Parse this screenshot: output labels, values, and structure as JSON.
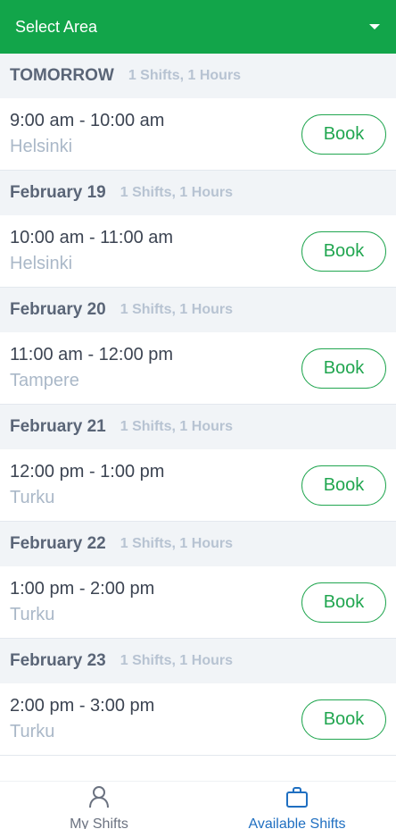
{
  "header": {
    "title": "Select Area"
  },
  "sections": [
    {
      "date": "TOMORROW",
      "meta": "1 Shifts, 1 Hours",
      "time": "9:00 am - 10:00 am",
      "city": "Helsinki",
      "button": "Book"
    },
    {
      "date": "February 19",
      "meta": "1 Shifts, 1 Hours",
      "time": "10:00 am - 11:00 am",
      "city": "Helsinki",
      "button": "Book"
    },
    {
      "date": "February 20",
      "meta": "1 Shifts, 1 Hours",
      "time": "11:00 am - 12:00 pm",
      "city": "Tampere",
      "button": "Book"
    },
    {
      "date": "February 21",
      "meta": "1 Shifts, 1 Hours",
      "time": "12:00 pm - 1:00 pm",
      "city": "Turku",
      "button": "Book"
    },
    {
      "date": "February 22",
      "meta": "1 Shifts, 1 Hours",
      "time": "1:00 pm - 2:00 pm",
      "city": "Turku",
      "button": "Book"
    },
    {
      "date": "February 23",
      "meta": "1 Shifts, 1 Hours",
      "time": "2:00 pm - 3:00 pm",
      "city": "Turku",
      "button": "Book"
    }
  ],
  "tabs": [
    {
      "label": "My Shifts",
      "icon": "user-icon",
      "active": false
    },
    {
      "label": "Available Shifts",
      "icon": "briefcase-icon",
      "active": true
    }
  ],
  "colors": {
    "accent": "#12a54a",
    "book": "#21a650",
    "tab_active": "#1f6fc1",
    "tab_inactive": "#6b7280"
  }
}
